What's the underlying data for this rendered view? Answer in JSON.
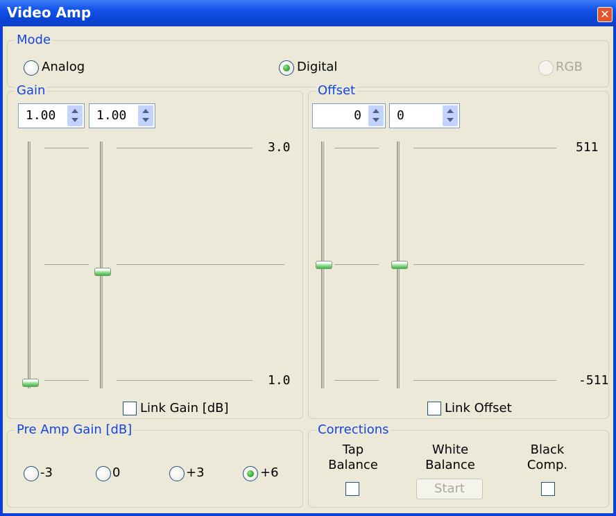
{
  "window": {
    "title": "Video Amp",
    "close_icon": "close-icon"
  },
  "mode": {
    "label": "Mode",
    "options": [
      "Analog",
      "Digital",
      "RGB"
    ],
    "selected": "Digital",
    "disabled": [
      "RGB"
    ]
  },
  "gain": {
    "label": "Gain",
    "spin1": "1.00",
    "spin2": "1.00",
    "scale_max": "3.0",
    "scale_min": "1.0",
    "slider1_level": 0.0,
    "slider2_level": 0.47,
    "link_label": "Link Gain [dB]",
    "link_checked": false
  },
  "offset": {
    "label": "Offset",
    "spin1": "0",
    "spin2": "0",
    "scale_max": "511",
    "scale_min": "-511",
    "slider1_level": 0.5,
    "slider2_level": 0.5,
    "link_label": "Link Offset",
    "link_checked": false
  },
  "preamp": {
    "label": "Pre Amp Gain [dB]",
    "options": [
      "-3",
      "0",
      "+3",
      "+6"
    ],
    "selected": "+6"
  },
  "corrections": {
    "label": "Corrections",
    "tap_line1": "Tap",
    "tap_line2": "Balance",
    "white_line1": "White",
    "white_line2": "Balance",
    "start_label": "Start",
    "black_line1": "Black",
    "black_line2": "Comp."
  },
  "colors": {
    "title_bar": "#0a45d8",
    "group_label": "#1446de",
    "face": "#ece9d8",
    "radio_dot": "#2fa12f"
  }
}
